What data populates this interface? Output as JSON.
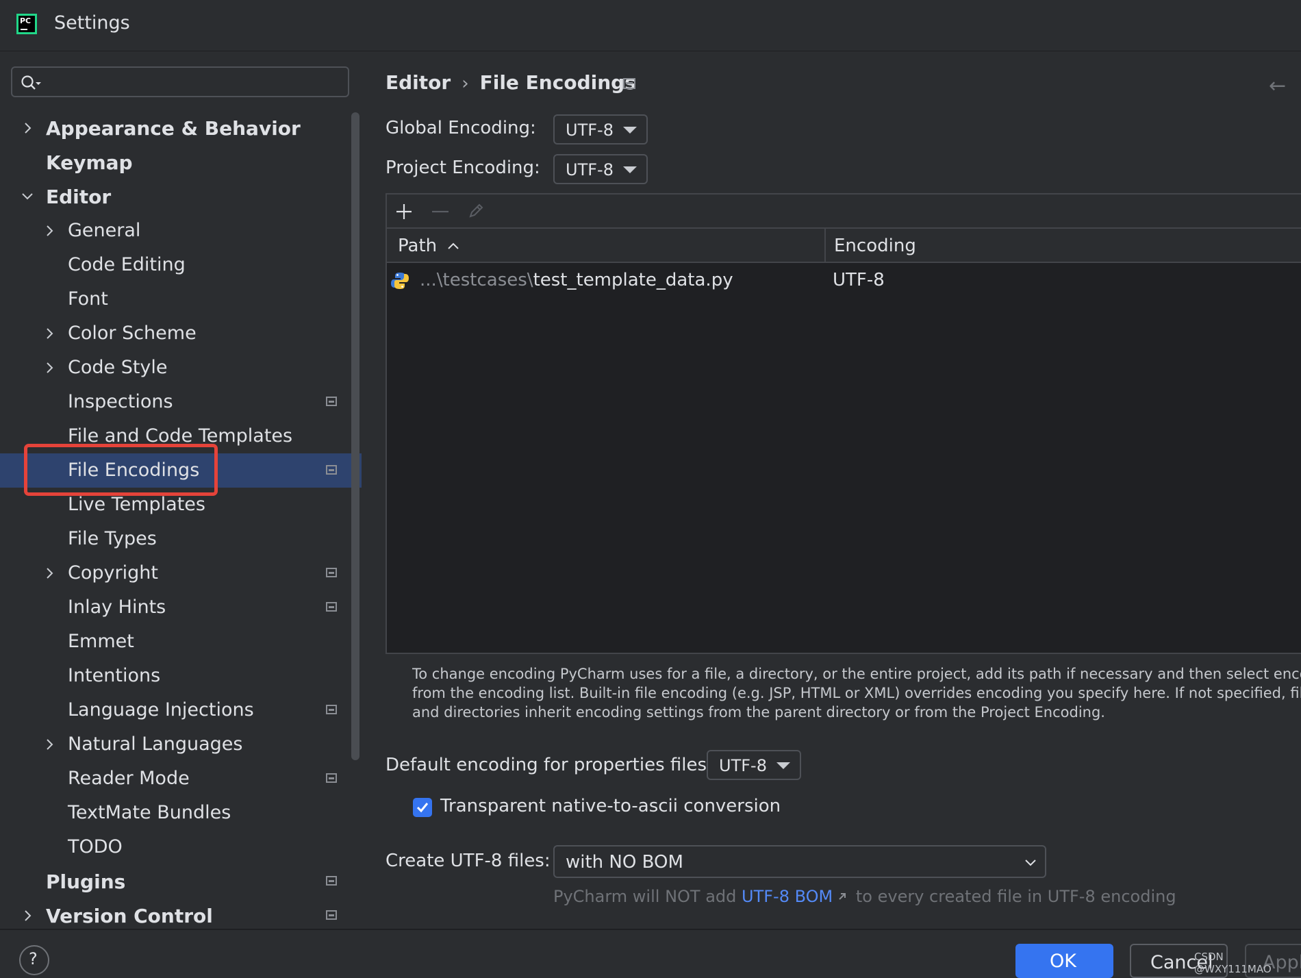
{
  "window": {
    "title": "Settings"
  },
  "app_logo": {
    "text": "PC"
  },
  "search": {
    "placeholder": ""
  },
  "sidebar": {
    "items": [
      {
        "label": "Appearance & Behavior",
        "level": 0,
        "expandable": true,
        "expanded": false,
        "project_icon": false
      },
      {
        "label": "Keymap",
        "level": 0,
        "expandable": false,
        "project_icon": false
      },
      {
        "label": "Editor",
        "level": 0,
        "expandable": true,
        "expanded": true,
        "project_icon": false
      },
      {
        "label": "General",
        "level": 1,
        "expandable": true,
        "expanded": false,
        "project_icon": false
      },
      {
        "label": "Code Editing",
        "level": 1,
        "expandable": false,
        "project_icon": false
      },
      {
        "label": "Font",
        "level": 1,
        "expandable": false,
        "project_icon": false
      },
      {
        "label": "Color Scheme",
        "level": 1,
        "expandable": true,
        "expanded": false,
        "project_icon": false
      },
      {
        "label": "Code Style",
        "level": 1,
        "expandable": true,
        "expanded": false,
        "project_icon": false
      },
      {
        "label": "Inspections",
        "level": 1,
        "expandable": false,
        "project_icon": true
      },
      {
        "label": "File and Code Templates",
        "level": 1,
        "expandable": false,
        "project_icon": false
      },
      {
        "label": "File Encodings",
        "level": 1,
        "expandable": false,
        "project_icon": true,
        "selected": true
      },
      {
        "label": "Live Templates",
        "level": 1,
        "expandable": false,
        "project_icon": false
      },
      {
        "label": "File Types",
        "level": 1,
        "expandable": false,
        "project_icon": false
      },
      {
        "label": "Copyright",
        "level": 1,
        "expandable": true,
        "expanded": false,
        "project_icon": true
      },
      {
        "label": "Inlay Hints",
        "level": 1,
        "expandable": false,
        "project_icon": true
      },
      {
        "label": "Emmet",
        "level": 1,
        "expandable": false,
        "project_icon": false
      },
      {
        "label": "Intentions",
        "level": 1,
        "expandable": false,
        "project_icon": false
      },
      {
        "label": "Language Injections",
        "level": 1,
        "expandable": false,
        "project_icon": true
      },
      {
        "label": "Natural Languages",
        "level": 1,
        "expandable": true,
        "expanded": false,
        "project_icon": false
      },
      {
        "label": "Reader Mode",
        "level": 1,
        "expandable": false,
        "project_icon": true
      },
      {
        "label": "TextMate Bundles",
        "level": 1,
        "expandable": false,
        "project_icon": false
      },
      {
        "label": "TODO",
        "level": 1,
        "expandable": false,
        "project_icon": false
      },
      {
        "label": "Plugins",
        "level": 0,
        "expandable": false,
        "project_icon": true
      },
      {
        "label": "Version Control",
        "level": 0,
        "expandable": true,
        "expanded": false,
        "project_icon": true
      }
    ]
  },
  "breadcrumb": {
    "parent": "Editor",
    "separator": "›",
    "current": "File Encodings"
  },
  "form": {
    "global_encoding_label": "Global Encoding:",
    "global_encoding_value": "UTF-8",
    "project_encoding_label": "Project Encoding:",
    "project_encoding_value": "UTF-8",
    "properties_label": "Default encoding for properties files:",
    "properties_value": "UTF-8",
    "native_to_ascii_label": "Transparent native-to-ascii conversion",
    "native_to_ascii_checked": true,
    "create_utf8_label": "Create UTF-8 files:",
    "create_utf8_value": "with NO BOM",
    "bom_note_before": "PyCharm will NOT add ",
    "bom_note_link": "UTF-8 BOM",
    "bom_note_after": " to every created file in UTF-8 encoding"
  },
  "table": {
    "columns": [
      "Path",
      "Encoding"
    ],
    "rows": [
      {
        "path_prefix": "...\\testcases\\",
        "path_file": "test_template_data.py",
        "encoding": "UTF-8"
      }
    ]
  },
  "help_text": [
    "To change encoding PyCharm uses for a file, a directory, or the entire project, add its path if necessary and then select encoding",
    "from the encoding list. Built-in file encoding (e.g. JSP, HTML or XML) overrides encoding you specify here. If not specified, files",
    "and directories inherit encoding settings from the parent directory or from the Project Encoding."
  ],
  "buttons": {
    "help": "?",
    "ok": "OK",
    "cancel": "Cancel",
    "apply": "Apply"
  },
  "watermark": "CSDN @WXY111MAO",
  "colors": {
    "accent": "#3574f0",
    "selection": "#2e436e",
    "highlight_box": "#e5433a",
    "link": "#548af7"
  }
}
